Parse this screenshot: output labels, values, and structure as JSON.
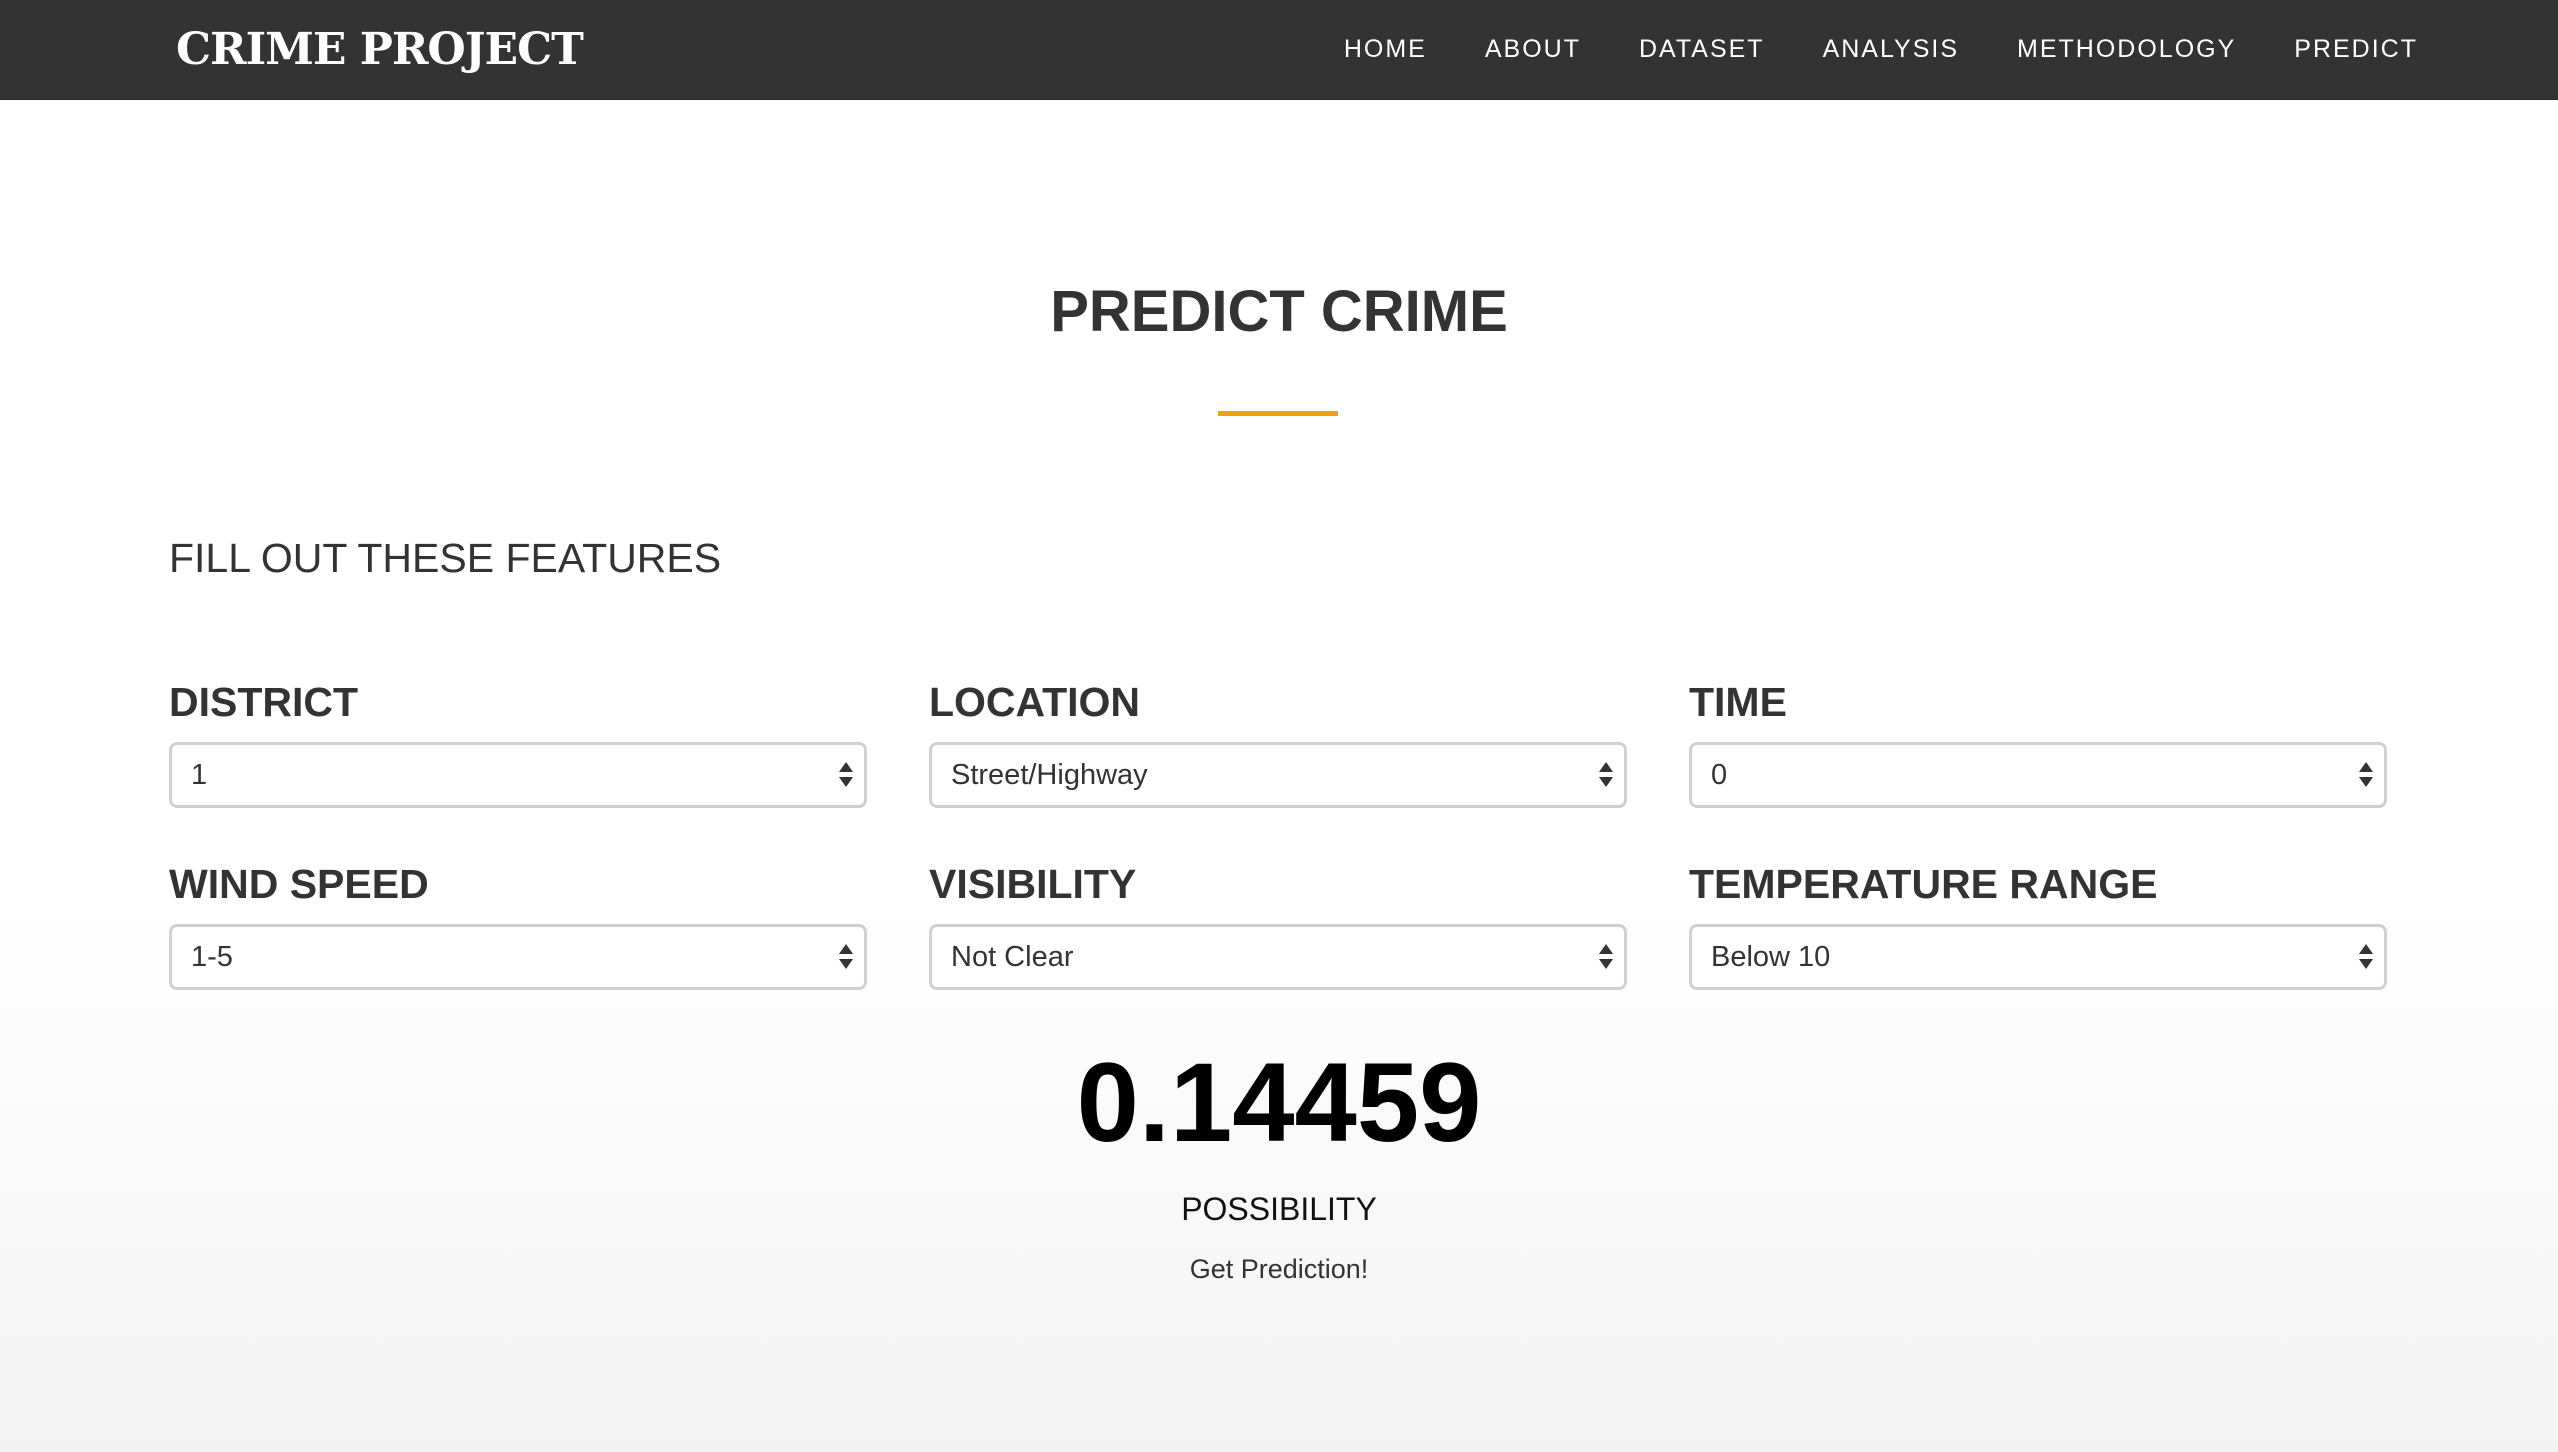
{
  "navbar": {
    "brand": "CRIME PROJECT",
    "links": [
      "HOME",
      "ABOUT",
      "DATASET",
      "ANALYSIS",
      "METHODOLOGY",
      "PREDICT"
    ]
  },
  "section": {
    "title": "PREDICT CRIME",
    "accent_color": "#f0a012",
    "subtitle": "FILL OUT THESE FEATURES"
  },
  "form": {
    "fields": [
      {
        "label": "DISTRICT",
        "value": "1"
      },
      {
        "label": "LOCATION",
        "value": "Street/Highway"
      },
      {
        "label": "TIME",
        "value": "0"
      },
      {
        "label": "WIND SPEED",
        "value": "1-5"
      },
      {
        "label": "VISIBILITY",
        "value": "Not Clear"
      },
      {
        "label": "TEMPERATURE RANGE",
        "value": "Below 10"
      }
    ]
  },
  "result": {
    "value": "0.14459",
    "label": "POSSIBILITY",
    "button_label": "Get Prediction!"
  },
  "colors": {
    "navbar_bg": "#333333",
    "text": "#333333",
    "accent": "#f0a012"
  }
}
